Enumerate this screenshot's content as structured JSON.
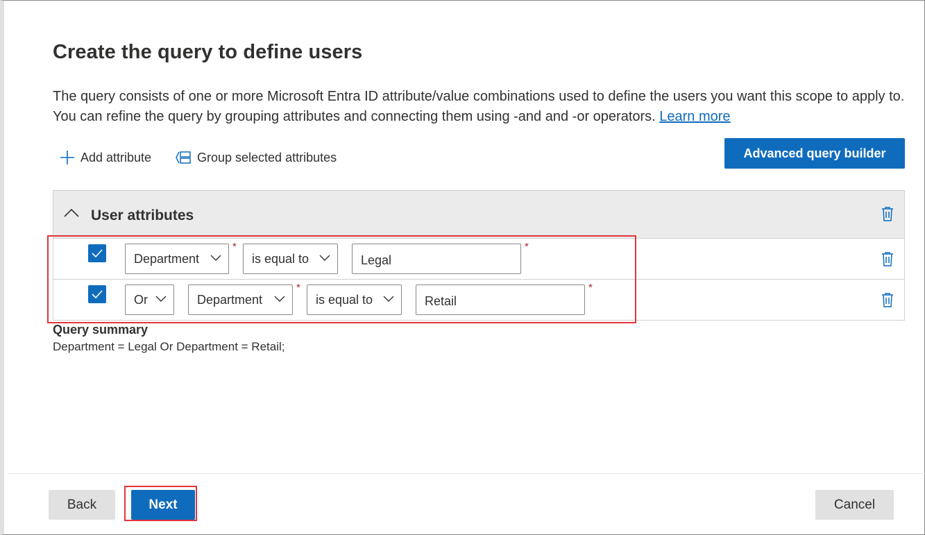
{
  "page": {
    "title": "Create the query to define users",
    "description": "The query consists of one or more Microsoft Entra ID attribute/value combinations used to define the users you want this scope to apply to. You can refine the query by grouping attributes and connecting them using -and and -or operators.",
    "learn_more": "Learn more"
  },
  "toolbar": {
    "add_attribute": "Add attribute",
    "group_selected": "Group selected attributes",
    "advanced_query_builder": "Advanced query builder"
  },
  "panel": {
    "header": "User attributes",
    "rows": [
      {
        "checked": true,
        "attribute": "Department",
        "operator": "is equal to",
        "value": "Legal"
      },
      {
        "checked": true,
        "connector": "Or",
        "attribute": "Department",
        "operator": "is equal to",
        "value": "Retail"
      }
    ],
    "required_marker": "*"
  },
  "summary": {
    "title": "Query summary",
    "text": "Department = Legal Or Department = Retail;"
  },
  "footer": {
    "back": "Back",
    "next": "Next",
    "cancel": "Cancel"
  },
  "colors": {
    "accent": "#0f6cbd",
    "highlight": "#e3343c",
    "required": "#a4262c"
  }
}
